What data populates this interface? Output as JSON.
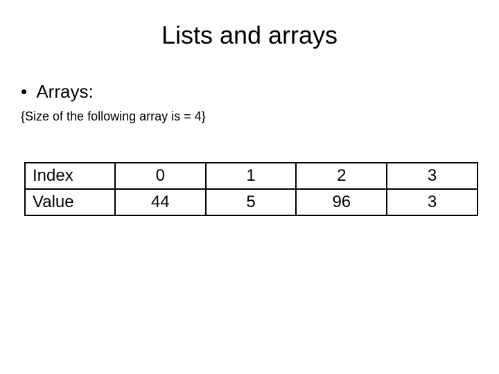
{
  "title": "Lists and arrays",
  "bullet": "Arrays:",
  "size_note": "{Size of the following array is = 4}",
  "table": {
    "row1": {
      "label": "Index",
      "c0": "0",
      "c1": "1",
      "c2": "2",
      "c3": "3"
    },
    "row2": {
      "label": "Value",
      "c0": "44",
      "c1": "5",
      "c2": "96",
      "c3": "3"
    }
  }
}
